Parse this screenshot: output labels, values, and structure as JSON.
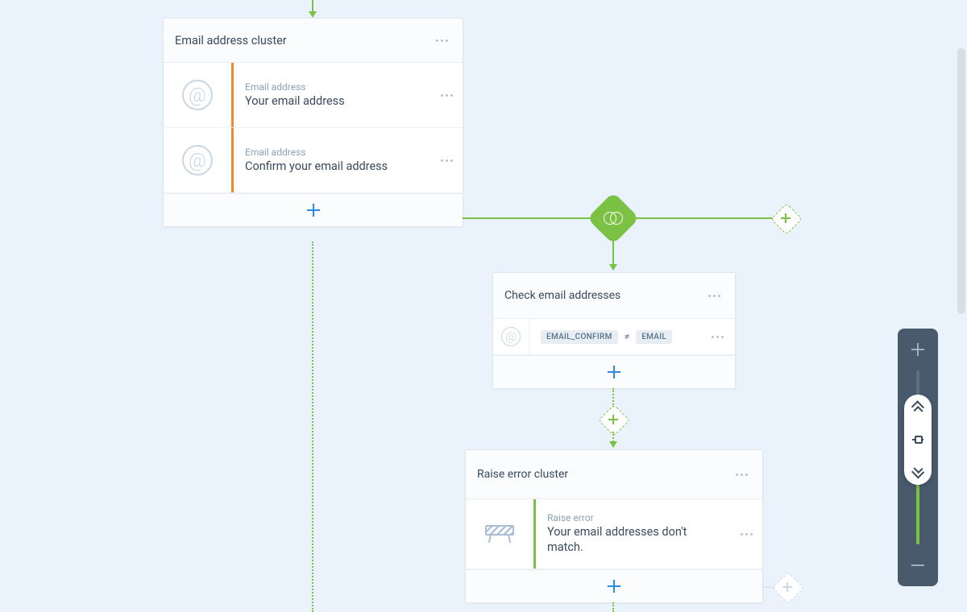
{
  "cluster1": {
    "title": "Email address cluster",
    "fields": [
      {
        "label": "Email address",
        "value": "Your email address"
      },
      {
        "label": "Email address",
        "value": "Confirm your email address"
      }
    ]
  },
  "cluster2": {
    "title": "Check email addresses",
    "condition": {
      "left": "EMAIL_CONFIRM",
      "op": "≠",
      "right": "EMAIL"
    }
  },
  "cluster3": {
    "title": "Raise error cluster",
    "field": {
      "label": "Raise error",
      "value": "Your email addresses don't match."
    }
  }
}
